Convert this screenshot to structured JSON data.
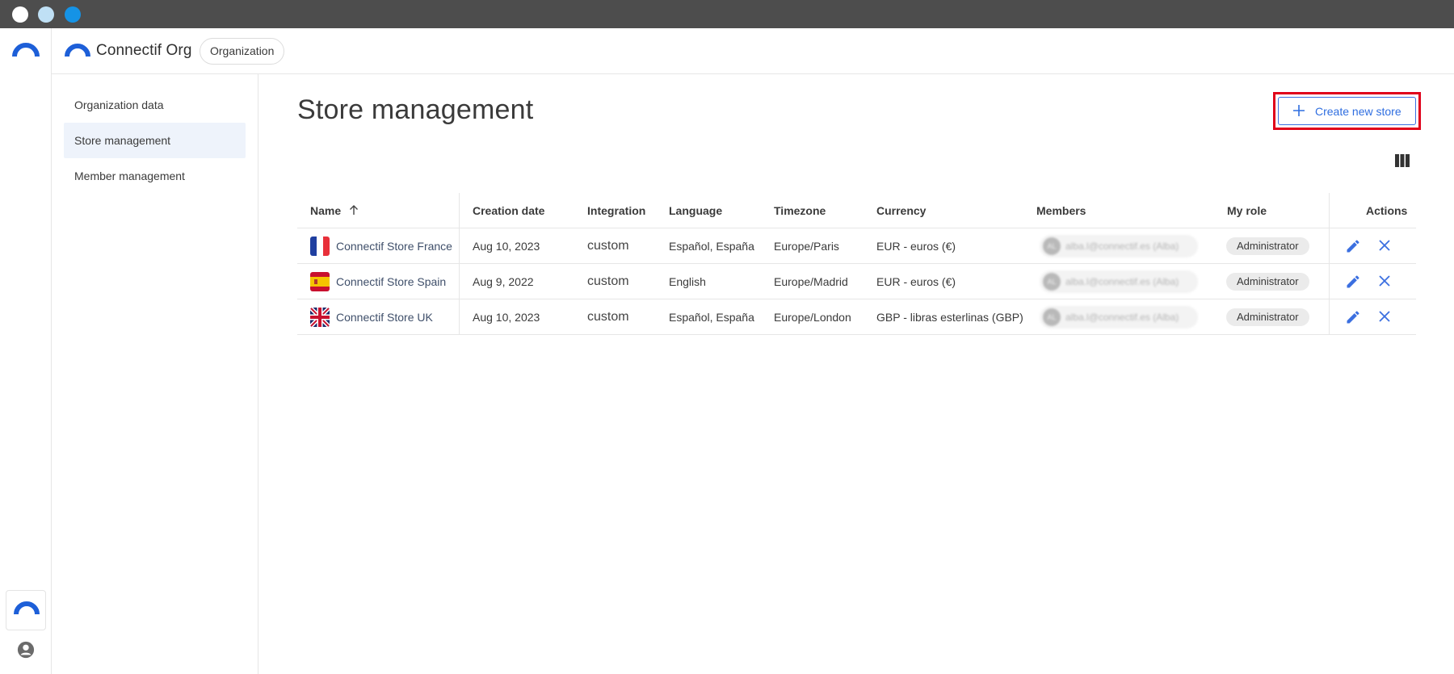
{
  "header": {
    "org_name": "Connectif Org",
    "org_chip": "Organization"
  },
  "sidenav": {
    "items": [
      {
        "label": "Organization data",
        "active": false
      },
      {
        "label": "Store management",
        "active": true
      },
      {
        "label": "Member management",
        "active": false
      }
    ]
  },
  "main": {
    "title": "Store management",
    "create_button": "Create new store"
  },
  "table": {
    "columns": [
      "Name",
      "Creation date",
      "Integration",
      "Language",
      "Timezone",
      "Currency",
      "Members",
      "My role",
      "Actions"
    ],
    "rows": [
      {
        "flag": "france-flag",
        "name": "Connectif Store France",
        "created": "Aug 10, 2023",
        "integration": "custom",
        "language": "Español, España",
        "timezone": "Europe/Paris",
        "currency": "EUR - euros (€)",
        "member": "alba.l@connectif.es (Alba)",
        "role": "Administrator"
      },
      {
        "flag": "spain-flag",
        "name": "Connectif Store Spain",
        "created": "Aug 9, 2022",
        "integration": "custom",
        "language": "English",
        "timezone": "Europe/Madrid",
        "currency": "EUR - euros (€)",
        "member": "alba.l@connectif.es (Alba)",
        "role": "Administrator"
      },
      {
        "flag": "uk-flag",
        "name": "Connectif Store UK",
        "created": "Aug 10, 2023",
        "integration": "custom",
        "language": "Español, España",
        "timezone": "Europe/London",
        "currency": "GBP - libras esterlinas (GBP)",
        "member": "alba.l@connectif.es (Alba)",
        "role": "Administrator"
      }
    ]
  },
  "colors": {
    "accent": "#2f6ee0",
    "brand_blue": "#1d5fd8",
    "highlight_border": "#e0001a"
  }
}
